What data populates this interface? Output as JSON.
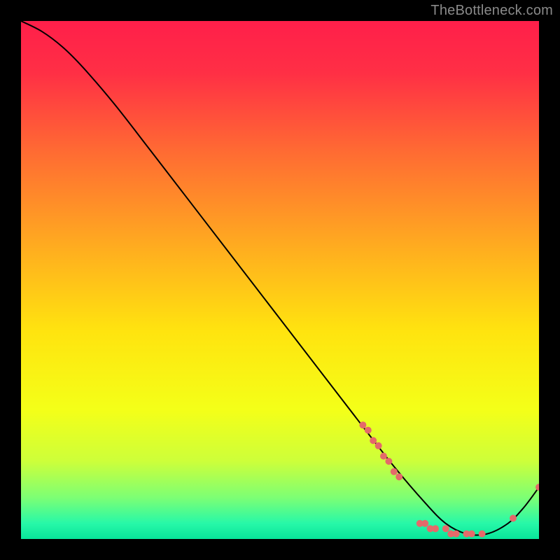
{
  "attribution": "TheBottleneck.com",
  "chart_data": {
    "type": "line",
    "title": "",
    "xlabel": "",
    "ylabel": "",
    "xlim": [
      0,
      100
    ],
    "ylim": [
      0,
      100
    ],
    "background_gradient": {
      "stops": [
        {
          "offset": 0.0,
          "color": "#ff1f4a"
        },
        {
          "offset": 0.1,
          "color": "#ff2f45"
        },
        {
          "offset": 0.25,
          "color": "#ff6a33"
        },
        {
          "offset": 0.45,
          "color": "#ffb11e"
        },
        {
          "offset": 0.6,
          "color": "#ffe40f"
        },
        {
          "offset": 0.75,
          "color": "#f4ff18"
        },
        {
          "offset": 0.85,
          "color": "#cdff3a"
        },
        {
          "offset": 0.92,
          "color": "#7dff74"
        },
        {
          "offset": 0.97,
          "color": "#27f8a8"
        },
        {
          "offset": 1.0,
          "color": "#08e59a"
        }
      ]
    },
    "curve": {
      "x": [
        0,
        4,
        8,
        12,
        18,
        25,
        35,
        45,
        55,
        65,
        72,
        78,
        82,
        86,
        90,
        94,
        97,
        100
      ],
      "y": [
        100,
        98,
        95,
        91,
        84,
        75,
        62,
        49,
        36,
        23,
        14,
        7,
        3,
        1,
        1,
        3,
        6,
        10
      ]
    },
    "markers": {
      "color": "#e46a6a",
      "radius": 5,
      "points": [
        {
          "x": 66,
          "y": 22
        },
        {
          "x": 67,
          "y": 21
        },
        {
          "x": 68,
          "y": 19
        },
        {
          "x": 69,
          "y": 18
        },
        {
          "x": 70,
          "y": 16
        },
        {
          "x": 71,
          "y": 15
        },
        {
          "x": 72,
          "y": 13
        },
        {
          "x": 73,
          "y": 12
        },
        {
          "x": 77,
          "y": 3
        },
        {
          "x": 78,
          "y": 3
        },
        {
          "x": 79,
          "y": 2
        },
        {
          "x": 80,
          "y": 2
        },
        {
          "x": 82,
          "y": 2
        },
        {
          "x": 83,
          "y": 1
        },
        {
          "x": 84,
          "y": 1
        },
        {
          "x": 86,
          "y": 1
        },
        {
          "x": 87,
          "y": 1
        },
        {
          "x": 89,
          "y": 1
        },
        {
          "x": 95,
          "y": 4
        },
        {
          "x": 100,
          "y": 10
        }
      ]
    }
  }
}
